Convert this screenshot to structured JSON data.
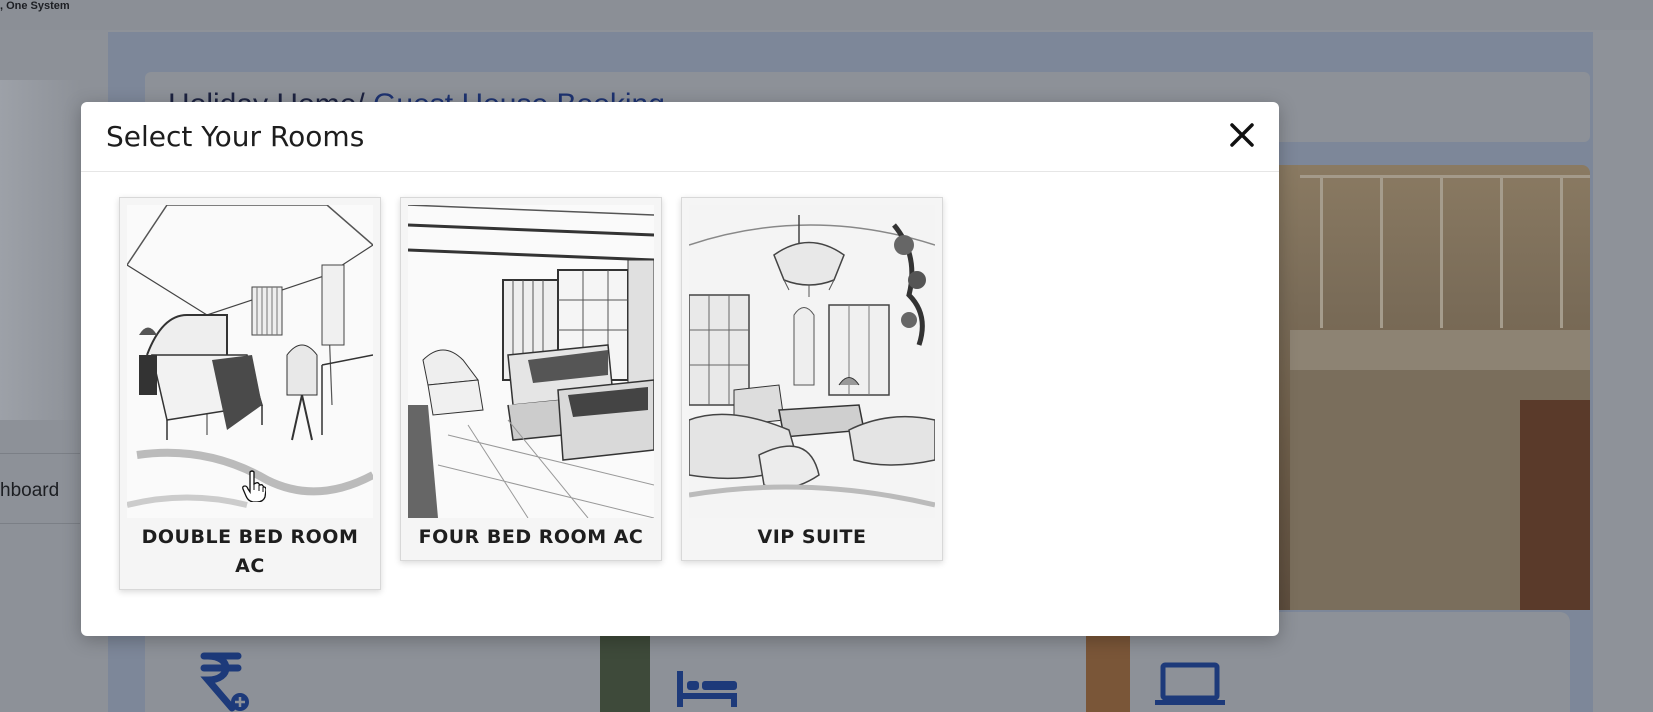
{
  "app": {
    "tagline": ", One System",
    "sidebar_dashboard_label": "hboard",
    "page_title_part1": "Holiday Home/ ",
    "page_title_part2": "Guest House Booking"
  },
  "modal": {
    "title": "Select Your Rooms",
    "close_icon": "close-icon",
    "rooms": [
      {
        "label": "DOUBLE BED ROOM AC"
      },
      {
        "label": "FOUR BED ROOM AC"
      },
      {
        "label": "VIP SUITE"
      }
    ]
  },
  "stat_icons": [
    "rupee-icon",
    "bed-icon",
    "laptop-icon"
  ],
  "colors": {
    "overlay": "#8e9299",
    "accent_blue": "#1d3a7a",
    "modal_bg": "#ffffff",
    "card_bg": "#f5f5f5"
  }
}
